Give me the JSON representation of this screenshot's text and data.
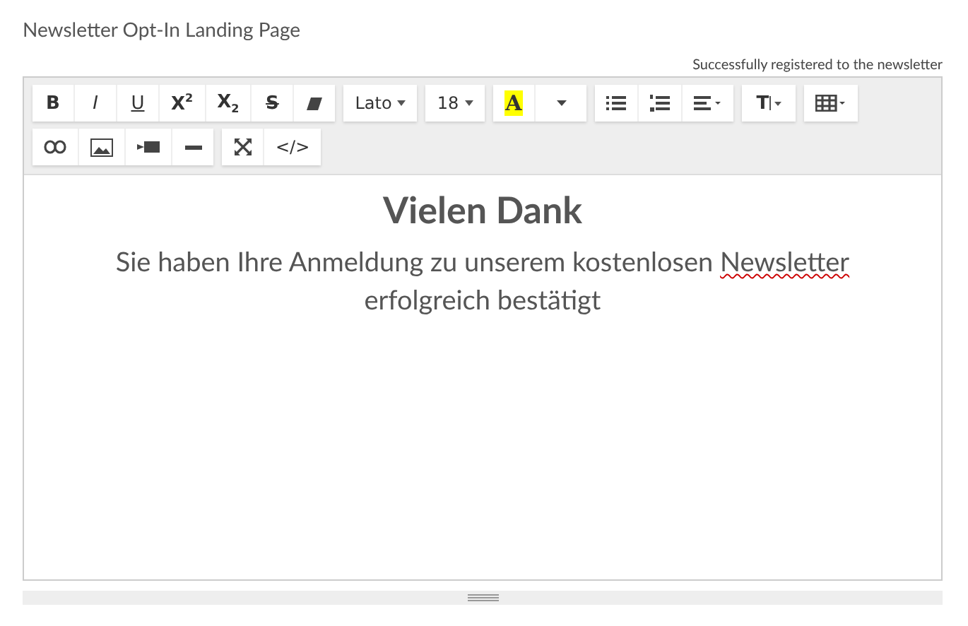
{
  "page_title": "Newsletter Opt-In Landing Page",
  "status": "Successfully registered to the newsletter",
  "toolbar": [
    [
      {
        "kind": "bold",
        "label": "B"
      },
      {
        "kind": "italic",
        "label": "I"
      },
      {
        "kind": "underline",
        "label": "U"
      },
      {
        "kind": "superscript",
        "label": "X$^{2}$"
      },
      {
        "kind": "subscript",
        "label": "X$_{2}$"
      },
      {
        "kind": "strike",
        "label": "S"
      },
      {
        "kind": "eraser"
      }
    ],
    [
      {
        "kind": "dropdown",
        "label": "Lato"
      }
    ],
    [
      {
        "kind": "dropdown",
        "label": "18"
      }
    ],
    [
      {
        "kind": "highlight",
        "label": "A",
        "color": "#ffff00"
      },
      {
        "kind": "caret"
      }
    ],
    [
      {
        "kind": "bullets"
      },
      {
        "kind": "numbers"
      },
      {
        "kind": "align"
      }
    ],
    [
      {
        "kind": "textsize",
        "label": "T"
      }
    ],
    [
      {
        "kind": "table"
      }
    ],
    [
      {
        "kind": "link"
      },
      {
        "kind": "image"
      },
      {
        "kind": "video"
      },
      {
        "kind": "rule"
      }
    ],
    [
      {
        "kind": "fullscreen"
      },
      {
        "kind": "code",
        "label": "</>"
      }
    ]
  ],
  "content": {
    "heading": "Vielen Dank",
    "paragraph": "Sie haben Ihre Anmeldung zu unserem kostenlosen",
    "misspelled": "Newsletter",
    "paragraph_end": "erfolgreich bestätigt"
  }
}
